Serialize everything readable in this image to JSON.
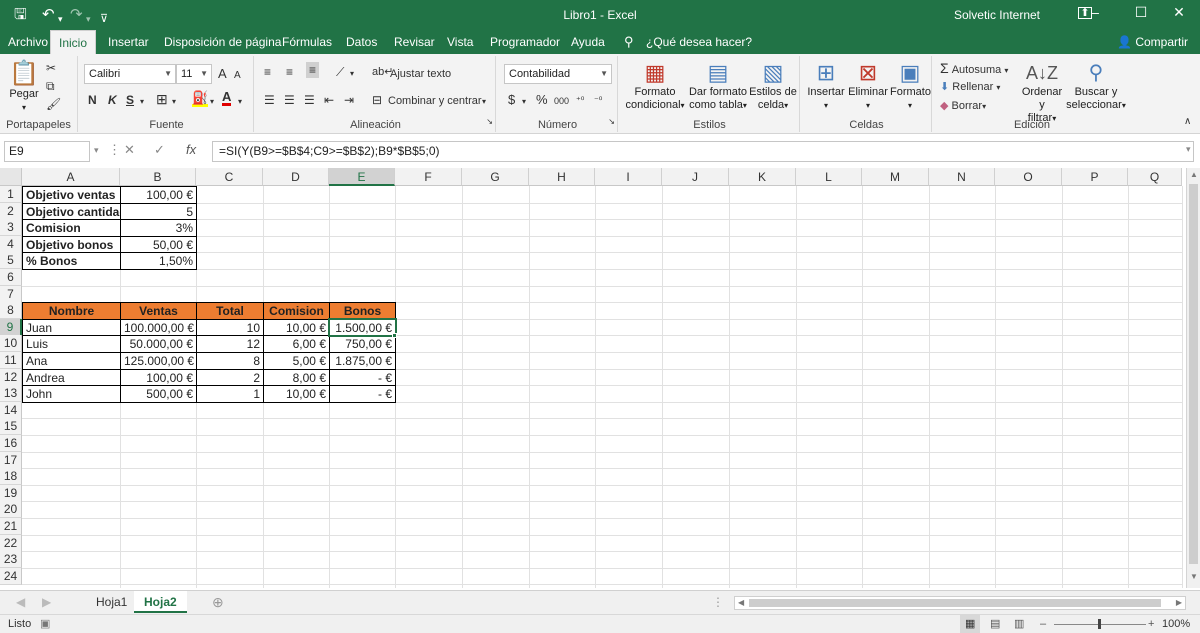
{
  "window": {
    "title": "Libro1  -  Excel",
    "user": "Solvetic Internet",
    "minimize": "–",
    "maximize": "☐",
    "close": "✕"
  },
  "tabs": [
    {
      "label": "Archivo",
      "x": 0
    },
    {
      "label": "Inicio",
      "x": 0
    },
    {
      "label": "Insertar",
      "x": 0
    },
    {
      "label": "Disposición de página",
      "x": 0
    },
    {
      "label": "Fórmulas",
      "x": 0
    },
    {
      "label": "Datos",
      "x": 0
    },
    {
      "label": "Revisar",
      "x": 0
    },
    {
      "label": "Vista",
      "x": 0
    },
    {
      "label": "Programador",
      "x": 0
    },
    {
      "label": "Ayuda",
      "x": 0
    }
  ],
  "tellme": "¿Qué desea hacer?",
  "share": "Compartir",
  "ribbon": {
    "clipboard": {
      "label": "Portapapeles",
      "paste": "Pegar"
    },
    "font": {
      "label": "Fuente",
      "name": "Calibri",
      "size": "11",
      "bold": "N",
      "italic": "K",
      "underline": "S",
      "grow": "A",
      "shrink": "A"
    },
    "alignment": {
      "label": "Alineación",
      "wrap": "Ajustar texto",
      "merge": "Combinar y centrar"
    },
    "number": {
      "label": "Número",
      "format": "Contabilidad",
      "currency": "$",
      "percent": "%",
      "thousands": "000"
    },
    "styles": {
      "label": "Estilos",
      "cond1": "Formato",
      "cond2": "condicional",
      "table1": "Dar formato",
      "table2": "como tabla",
      "cell1": "Estilos de",
      "cell2": "celda"
    },
    "cells": {
      "label": "Celdas",
      "insert": "Insertar",
      "delete": "Eliminar",
      "format": "Formato"
    },
    "editing": {
      "label": "Edición",
      "autosum": "Autosuma",
      "fill": "Rellenar",
      "clear": "Borrar",
      "sort1": "Ordenar y",
      "sort2": "filtrar",
      "find1": "Buscar y",
      "find2": "seleccionar"
    }
  },
  "formula_bar": {
    "namebox": "E9",
    "formula": "=SI(Y(B9>=$B$4;C9>=$B$2);B9*$B$5;0)",
    "fx": "fx"
  },
  "columns": [
    "A",
    "B",
    "C",
    "D",
    "E",
    "F",
    "G",
    "H",
    "I",
    "J",
    "K",
    "L",
    "M",
    "N",
    "O",
    "P",
    "Q"
  ],
  "rows": [
    "1",
    "2",
    "3",
    "4",
    "5",
    "6",
    "7",
    "8",
    "9",
    "10",
    "11",
    "12",
    "13",
    "14",
    "15",
    "16",
    "17",
    "18",
    "19",
    "20",
    "21",
    "22",
    "23",
    "24"
  ],
  "params": [
    {
      "label": "Objetivo ventas",
      "value": "100,00 €"
    },
    {
      "label": "Objetivo cantidad",
      "value": "5"
    },
    {
      "label": "Comision",
      "value": "3%"
    },
    {
      "label": "Objetivo bonos",
      "value": "50,00 €"
    },
    {
      "label": "% Bonos",
      "value": "1,50%"
    }
  ],
  "table": {
    "headers": [
      "Nombre",
      "Ventas",
      "Total",
      "Comision",
      "Bonos"
    ],
    "rows": [
      [
        "Juan",
        "100.000,00 €",
        "10",
        "10,00 €",
        "1.500,00 €"
      ],
      [
        "Luis",
        "50.000,00 €",
        "12",
        "6,00 €",
        "750,00 €"
      ],
      [
        "Ana",
        "125.000,00 €",
        "8",
        "5,00 €",
        "1.875,00 €"
      ],
      [
        "Andrea",
        "100,00 €",
        "2",
        "8,00 €",
        "-      €"
      ],
      [
        "John",
        "500,00 €",
        "1",
        "10,00 €",
        "-      €"
      ]
    ]
  },
  "sheets": [
    "Hoja1",
    "Hoja2"
  ],
  "status": {
    "ready": "Listo",
    "zoom": "100%"
  },
  "colors": {
    "excel_green": "#217346",
    "header_orange": "#ed7d31"
  }
}
